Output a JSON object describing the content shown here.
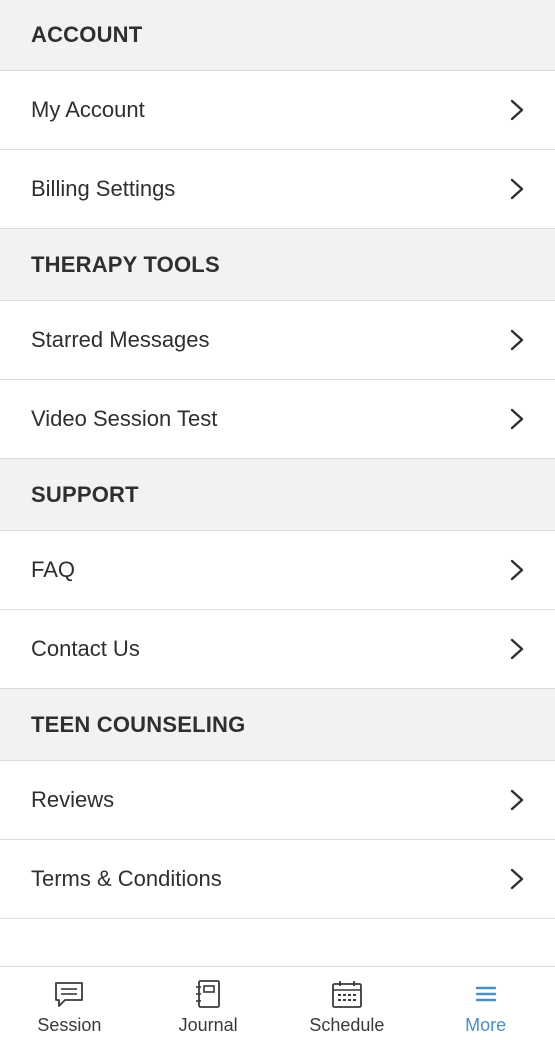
{
  "sections": [
    {
      "header": "ACCOUNT",
      "items": [
        {
          "label": "My Account"
        },
        {
          "label": "Billing Settings"
        }
      ]
    },
    {
      "header": "THERAPY TOOLS",
      "items": [
        {
          "label": "Starred Messages"
        },
        {
          "label": "Video Session Test"
        }
      ]
    },
    {
      "header": "SUPPORT",
      "items": [
        {
          "label": "FAQ"
        },
        {
          "label": "Contact Us"
        }
      ]
    },
    {
      "header": "TEEN COUNSELING",
      "items": [
        {
          "label": "Reviews"
        },
        {
          "label": "Terms & Conditions"
        }
      ]
    }
  ],
  "tabbar": {
    "tabs": [
      {
        "label": "Session",
        "icon": "chat-bubble-icon",
        "active": false
      },
      {
        "label": "Journal",
        "icon": "notebook-icon",
        "active": false
      },
      {
        "label": "Schedule",
        "icon": "calendar-icon",
        "active": false
      },
      {
        "label": "More",
        "icon": "hamburger-menu-icon",
        "active": true
      }
    ],
    "active_color": "#4a8fc9"
  }
}
